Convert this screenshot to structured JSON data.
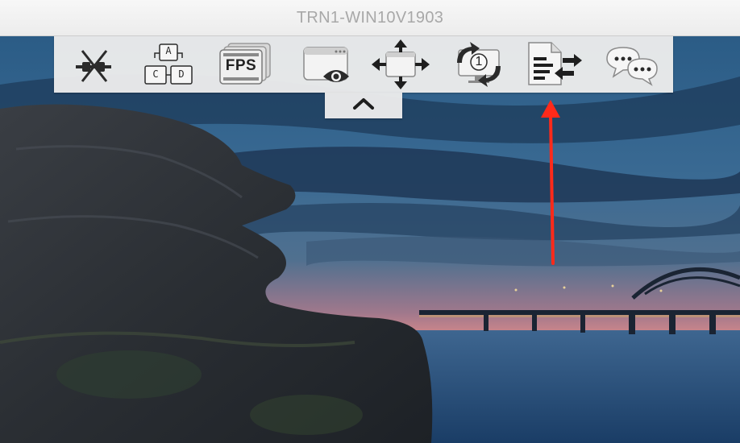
{
  "window": {
    "title": "TRN1-WIN10V1903"
  },
  "toolbar": {
    "buttons": [
      {
        "name": "disconnect",
        "icon": "disconnect-plug-icon"
      },
      {
        "name": "ctrl-alt-del",
        "icon": "ctrl-alt-del-keys-icon",
        "keys": [
          "A",
          "C",
          "D"
        ]
      },
      {
        "name": "fps",
        "icon": "fps-icon",
        "label": "FPS"
      },
      {
        "name": "view-only",
        "icon": "view-eye-icon"
      },
      {
        "name": "fullscreen",
        "icon": "move-arrows-icon"
      },
      {
        "name": "switch-monitor",
        "icon": "monitor-switch-icon",
        "monitor_number": "1"
      },
      {
        "name": "file-transfer",
        "icon": "file-transfer-icon"
      },
      {
        "name": "chat",
        "icon": "chat-bubbles-icon"
      }
    ],
    "collapse_icon": "chevron-up-icon"
  },
  "annotation": {
    "color": "#ff2a1a",
    "icon": "red-arrow-annotation"
  },
  "colors": {
    "icon_dark": "#2b2b2b",
    "toolbar_bg": "#ececec",
    "title_text": "#a8a8a8"
  }
}
